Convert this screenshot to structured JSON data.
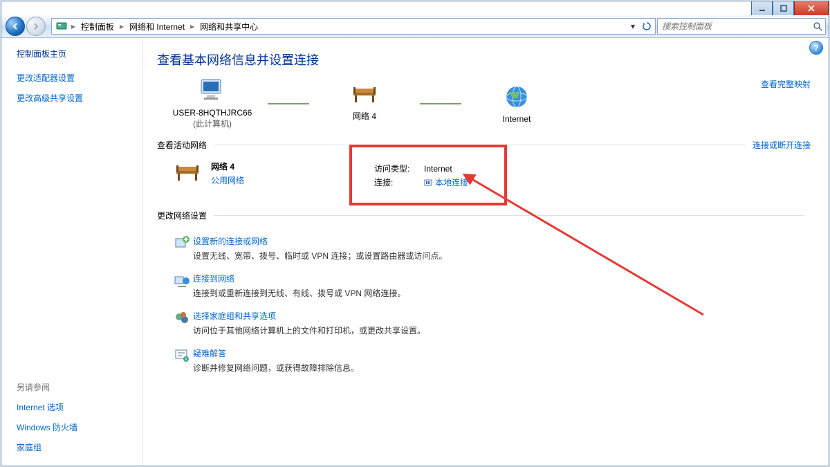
{
  "breadcrumbs": {
    "root": "",
    "a": "控制面板",
    "b": "网络和 Internet",
    "c": "网络和共享中心"
  },
  "search": {
    "placeholder": "搜索控制面板"
  },
  "sidebar": {
    "home": "控制面板主页",
    "items": [
      "更改适配器设置",
      "更改高级共享设置"
    ],
    "seeAlsoHdr": "另请参阅",
    "seeAlso": [
      "Internet 选项",
      "Windows 防火墙",
      "家庭组"
    ]
  },
  "title": "查看基本网络信息并设置连接",
  "map": {
    "pc": "USER-8HQTHJRC66",
    "pcSub": "(此计算机)",
    "net": "网络  4",
    "internet": "Internet",
    "fullMap": "查看完整映射"
  },
  "activeHdr": "查看活动网络",
  "activeRight": "连接或断开连接",
  "active": {
    "name": "网络  4",
    "type": "公用网络",
    "accessLbl": "访问类型:",
    "accessVal": "Internet",
    "connLbl": "连接:",
    "connVal": "本地连接"
  },
  "settingsHdr": "更改网络设置",
  "tasks": [
    {
      "h": "设置新的连接或网络",
      "d": "设置无线、宽带、拨号、临时或 VPN 连接；或设置路由器或访问点。"
    },
    {
      "h": "连接到网络",
      "d": "连接到或重新连接到无线、有线、拨号或 VPN 网络连接。"
    },
    {
      "h": "选择家庭组和共享选项",
      "d": "访问位于其他网络计算机上的文件和打印机，或更改共享设置。"
    },
    {
      "h": "疑难解答",
      "d": "诊断并修复网络问题，或获得故障排除信息。"
    }
  ]
}
